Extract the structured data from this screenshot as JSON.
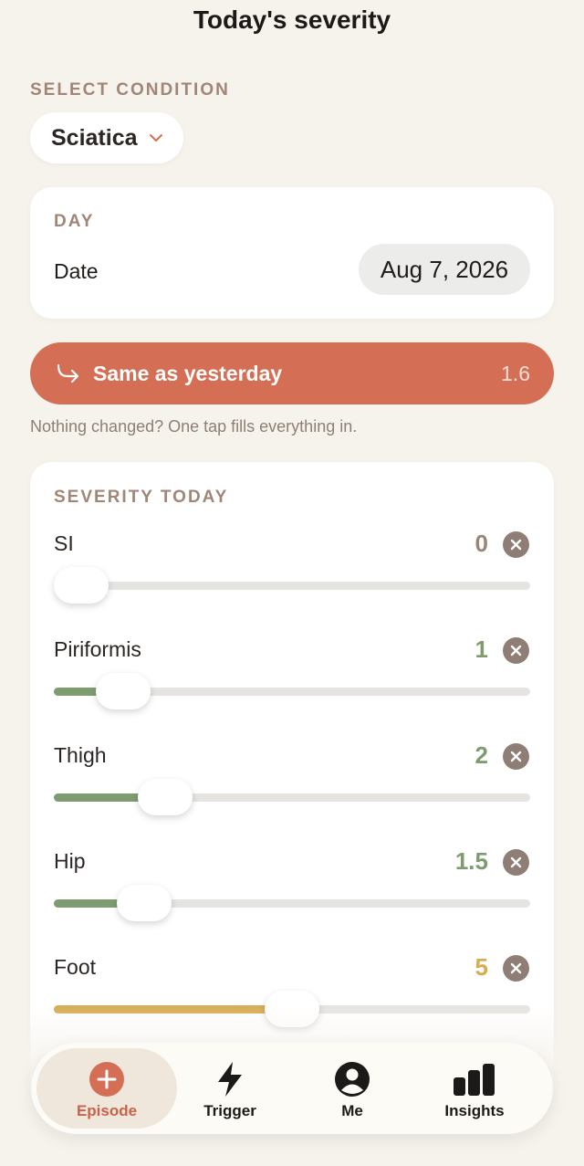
{
  "header": {
    "title": "Today's severity"
  },
  "condition": {
    "label": "SELECT CONDITION",
    "selected": "Sciatica"
  },
  "day": {
    "label": "DAY",
    "date_label": "Date",
    "date_value": "Aug 7, 2026"
  },
  "same_as_yesterday": {
    "label": "Same as yesterday",
    "value": "1.6",
    "hint": "Nothing changed? One tap fills everything in."
  },
  "severity": {
    "label": "SEVERITY TODAY",
    "items": [
      {
        "name": "SI",
        "value": "0",
        "level": 0,
        "color": "#9a857a"
      },
      {
        "name": "Piriformis",
        "value": "1",
        "level": 0.1,
        "color": "#7f9c70"
      },
      {
        "name": "Thigh",
        "value": "2",
        "level": 0.2,
        "color": "#7f9c70"
      },
      {
        "name": "Hip",
        "value": "1.5",
        "level": 0.15,
        "color": "#7f9c70"
      },
      {
        "name": "Foot",
        "value": "5",
        "level": 0.5,
        "color": "#d6ab52"
      }
    ]
  },
  "tabs": [
    {
      "label": "Episode",
      "icon": "plus-circle-icon",
      "active": true
    },
    {
      "label": "Trigger",
      "icon": "bolt-icon",
      "active": false
    },
    {
      "label": "Me",
      "icon": "person-icon",
      "active": false
    },
    {
      "label": "Insights",
      "icon": "bar-chart-icon",
      "active": false
    }
  ],
  "colors": {
    "accent": "#d46f56",
    "background": "#f6f2ec",
    "green": "#7f9c70",
    "yellow": "#d6ab52"
  }
}
